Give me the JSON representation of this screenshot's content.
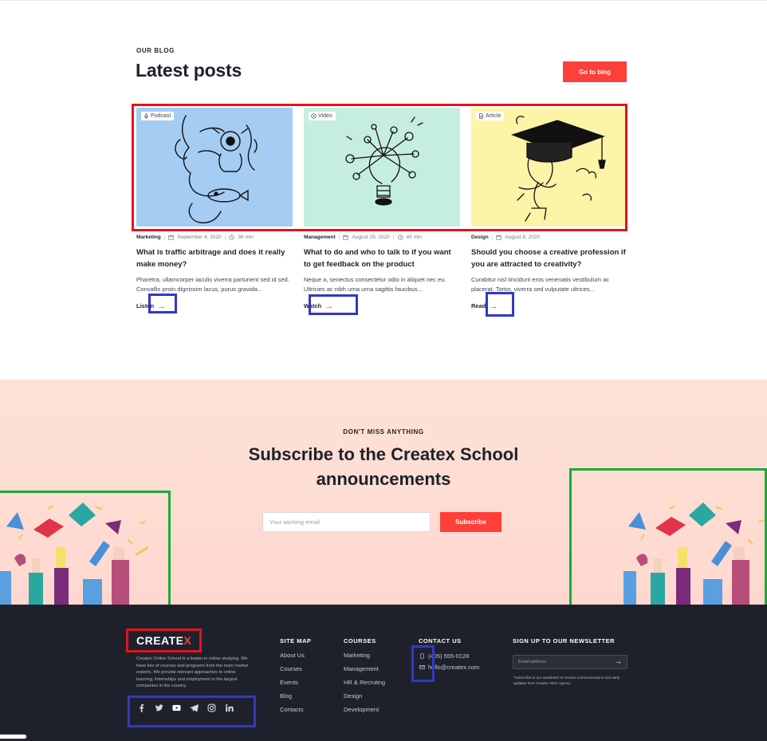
{
  "blog": {
    "eyebrow": "OUR BLOG",
    "title": "Latest posts",
    "go_button": "Go to blog",
    "posts": [
      {
        "tag": "Podcast",
        "category": "Marketing",
        "date": "September 4, 2020",
        "duration": "36 min",
        "title": "What is traffic arbitrage and does it really make money?",
        "excerpt": "Pharetra, ullamcorper iaculis viverra parturient sed id sed. Convallis proin dignissim lacus, purus gravida...",
        "action": "Listen",
        "image_bg": "#a5cdf4"
      },
      {
        "tag": "Video",
        "category": "Management",
        "date": "August 25, 2020",
        "duration": "45 min",
        "title": "What to do and who to talk to if you want to get feedback on the product",
        "excerpt": "Neque a, senectus consectetur odio in aliquet nec eu. Ultricies ac nibh urna urna sagittis faucibus...",
        "action": "Watch",
        "image_bg": "#c6eee0"
      },
      {
        "tag": "Article",
        "category": "Design",
        "date": "August 8, 2020",
        "duration": "",
        "title": "Should you choose a creative profession if you are attracted to creativity?",
        "excerpt": "Curabitur nisl tincidunt eros venenatis vestibulum ac placerat. Tortor, viverra sed vulputate ultrices...",
        "action": "Read",
        "image_bg": "#fdf4a8"
      }
    ]
  },
  "subscribe": {
    "eyebrow": "DON'T MISS ANYTHING",
    "title": "Subscribe to the Createx School announcements",
    "email_placeholder": "Your working email",
    "button": "Subscribe"
  },
  "footer": {
    "logo_main": "CREATE",
    "logo_x": "X",
    "about": "Createx Online School is a leader in online studying. We have lots of courses and programs from the main market experts. We provide relevant approaches to online learning, internships and employment in the largest companies in the country.",
    "socials": [
      "facebook-icon",
      "twitter-icon",
      "youtube-icon",
      "telegram-icon",
      "instagram-icon",
      "linkedin-icon"
    ],
    "sitemap": {
      "heading": "SITE MAP",
      "items": [
        "About Us",
        "Courses",
        "Events",
        "Blog",
        "Contacts"
      ]
    },
    "courses": {
      "heading": "COURSES",
      "items": [
        "Marketing",
        "Management",
        "HR & Recruting",
        "Design",
        "Development"
      ]
    },
    "contact": {
      "heading": "CONTACT US",
      "phone": "(405) 555-0128",
      "email": "hello@createx.com"
    },
    "newsletter": {
      "heading": "SIGN UP TO OUR NEWSLETTER",
      "placeholder": "Email address",
      "note": "*Subscribe to our newsletter to receive communications and early updates from Createx SEO Agency."
    }
  },
  "colors": {
    "accent": "#ff3f3a",
    "dark": "#1e212c"
  }
}
